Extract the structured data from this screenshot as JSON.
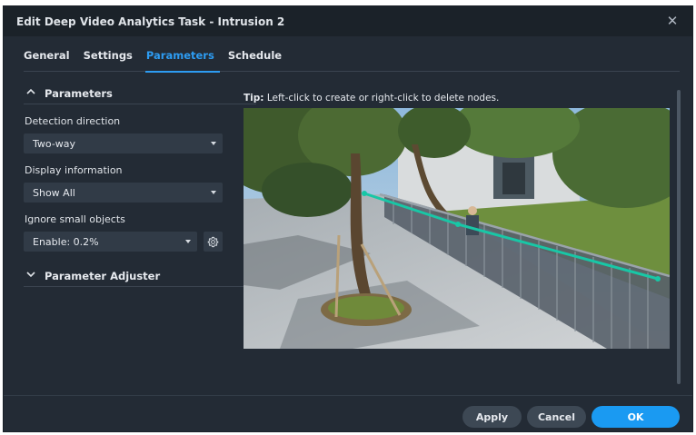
{
  "window": {
    "title": "Edit Deep Video Analytics Task - Intrusion 2",
    "close_icon": "close-icon"
  },
  "tabs": [
    {
      "label": "General",
      "active": false
    },
    {
      "label": "Settings",
      "active": false
    },
    {
      "label": "Parameters",
      "active": true
    },
    {
      "label": "Schedule",
      "active": false
    }
  ],
  "parameters": {
    "section_title": "Parameters",
    "detection_direction": {
      "label": "Detection direction",
      "value": "Two-way"
    },
    "display_information": {
      "label": "Display information",
      "value": "Show All"
    },
    "ignore_small_objects": {
      "label": "Ignore small objects",
      "value": "Enable: 0.2%"
    },
    "adjuster_title": "Parameter Adjuster"
  },
  "tip": {
    "prefix": "Tip:",
    "text": "Left-click to create or right-click to delete nodes."
  },
  "footer": {
    "apply_label": "Apply",
    "cancel_label": "Cancel",
    "ok_label": "OK"
  },
  "colors": {
    "accent": "#2d9cf2",
    "ok_button": "#1a9af2",
    "detection_line": "#18c7a6",
    "background": "#232b35"
  }
}
